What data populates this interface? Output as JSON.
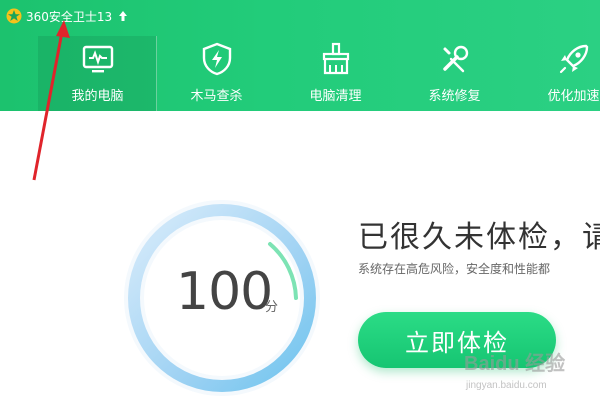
{
  "titlebar": {
    "app_title": "360安全卫士13",
    "logo_icon": "360-logo-icon",
    "update_icon": "up-arrow-icon"
  },
  "nav": {
    "items": [
      {
        "label": "我的电脑",
        "icon": "monitor-icon",
        "active": true
      },
      {
        "label": "木马查杀",
        "icon": "shield-bolt-icon",
        "active": false
      },
      {
        "label": "电脑清理",
        "icon": "broom-icon",
        "active": false
      },
      {
        "label": "系统修复",
        "icon": "wrench-icon",
        "active": false
      },
      {
        "label": "优化加速",
        "icon": "rocket-icon",
        "active": false
      }
    ]
  },
  "main": {
    "score": "100",
    "score_unit": "分",
    "headline": "已很久未体检，请",
    "subtext": "系统存在高危风险，安全度和性能都",
    "check_button_label": "立即体检"
  },
  "colors": {
    "brand_green": "#22cc7a",
    "annotation_red": "#e0242b",
    "text_dark": "#333333"
  },
  "watermark": {
    "text": "Baidu 经验",
    "subtext": "jingyan.baidu.com"
  }
}
